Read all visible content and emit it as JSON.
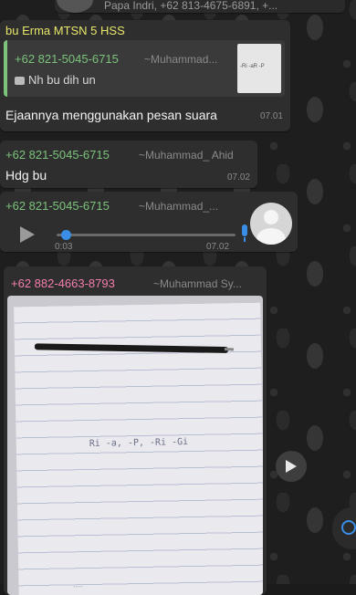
{
  "top": {
    "cut_text": "Papa Indri, +62 813-4675-6891, +..."
  },
  "msg1": {
    "group_name": "bu Erma MTSN 5 HSS",
    "quote_sender": "+62 821-5045-6715",
    "quote_alias": "~Muhammad...",
    "quote_text": "Nh bu dih un",
    "thumb_text": "-Ri -aR -P",
    "text": "Ejaannya menggunakan pesan suara",
    "time": "07.01"
  },
  "msg2": {
    "sender": "+62 821-5045-6715",
    "alias": "~Muhammad_ Ahid",
    "text": "Hdg bu",
    "time": "07.02"
  },
  "msg3": {
    "sender": "+62 821-5045-6715",
    "alias": "~Muhammad_...",
    "duration": "0:03",
    "time": "07.02",
    "progress": 0.05
  },
  "msg4": {
    "sender": "+62 882-4663-8793",
    "alias": "~Muhammad Sy...",
    "paper_text": "Ri -a, -P, -Ri -Gi",
    "bottom_text": "...."
  },
  "colors": {
    "bubble": "#2e2e2e",
    "sender_green": "#7cc37c",
    "sender_pink": "#f47fae",
    "accent_blue": "#3a8ee6"
  }
}
